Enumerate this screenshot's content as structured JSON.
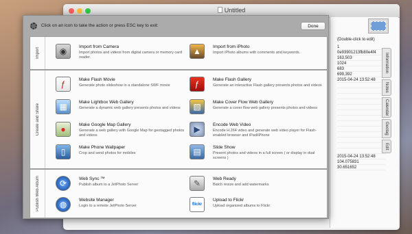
{
  "window": {
    "title": "Untitled"
  },
  "side_panel": {
    "double_click_hint": "(Double-click to edit)",
    "values": [
      "1",
      "0e93901213fb80e4f4",
      "163,503",
      "1024",
      "683",
      "699,392",
      "2015-04-24 13:52:48",
      "",
      "",
      "",
      "",
      "",
      "",
      "",
      "",
      "",
      "",
      "",
      "",
      "",
      "2015-04-24 13:52:48",
      "104.075831",
      "30.651652"
    ],
    "tabs": [
      "Information",
      "Notes",
      "Calendar",
      "Geotag",
      "Edit"
    ]
  },
  "overlay": {
    "instruction": "Click on an icon to take the action or press ESC key to exit:",
    "done_label": "Done",
    "sections": {
      "import": {
        "label": "Import"
      },
      "create": {
        "label": "Create and Share"
      },
      "publish": {
        "label": "Publish Web Album"
      }
    },
    "items": {
      "import_camera": {
        "title": "Import from Camera",
        "desc": "Import photos and videos from digital camera or memory card reader."
      },
      "import_iphoto": {
        "title": "Import from iPhoto",
        "desc": "Import iPhoto albums with comments and keywords."
      },
      "flash_movie": {
        "title": "Make Flash Movie",
        "desc": "Generate photo slideshow in a standalone SWF movie"
      },
      "flash_gallery": {
        "title": "Make Flash Gallery",
        "desc": "Generate an interactive Flash gallery presents photos and videos"
      },
      "lightbox": {
        "title": "Make Lightbox Web Gallery",
        "desc": "Generate a dynamic web gallery presents photos and videos"
      },
      "coverflow": {
        "title": "Make Cover Flow Web Gallery",
        "desc": "Generate a cover flow web gallery presents photos and videos"
      },
      "googlemap": {
        "title": "Make Google Map Gallery",
        "desc": "Generate a web gallery with Google Map for geotagged photos and videos"
      },
      "encode_video": {
        "title": "Encode Web Video",
        "desc": "Encode H.264 video and generate web video player for Flash-enabled browser and iPad/iPhone"
      },
      "phone_wallpaper": {
        "title": "Make Phone Wallpaper",
        "desc": "Crop and send photos for mobiles"
      },
      "slideshow": {
        "title": "Slide Show",
        "desc": "Present photos and videos in a full screen ( or display in dual screens )"
      },
      "websync": {
        "title": "Web Sync ™",
        "desc": "Publish album to a JetPhoto Server"
      },
      "webready": {
        "title": "Web Ready",
        "desc": "Batch resize and add watermarks"
      },
      "website_manager": {
        "title": "Website Manager",
        "desc": "Login to a remote JetPhoto Server"
      },
      "flickr": {
        "title": "Upload to Flickr",
        "desc": "Upload organized albums to Flickr",
        "icon_text": "flickr"
      }
    }
  },
  "colors": {
    "overlay_bg": "#ababab",
    "section_bg": "#fbfbfb",
    "accent_blue": "#2a6fd6"
  }
}
